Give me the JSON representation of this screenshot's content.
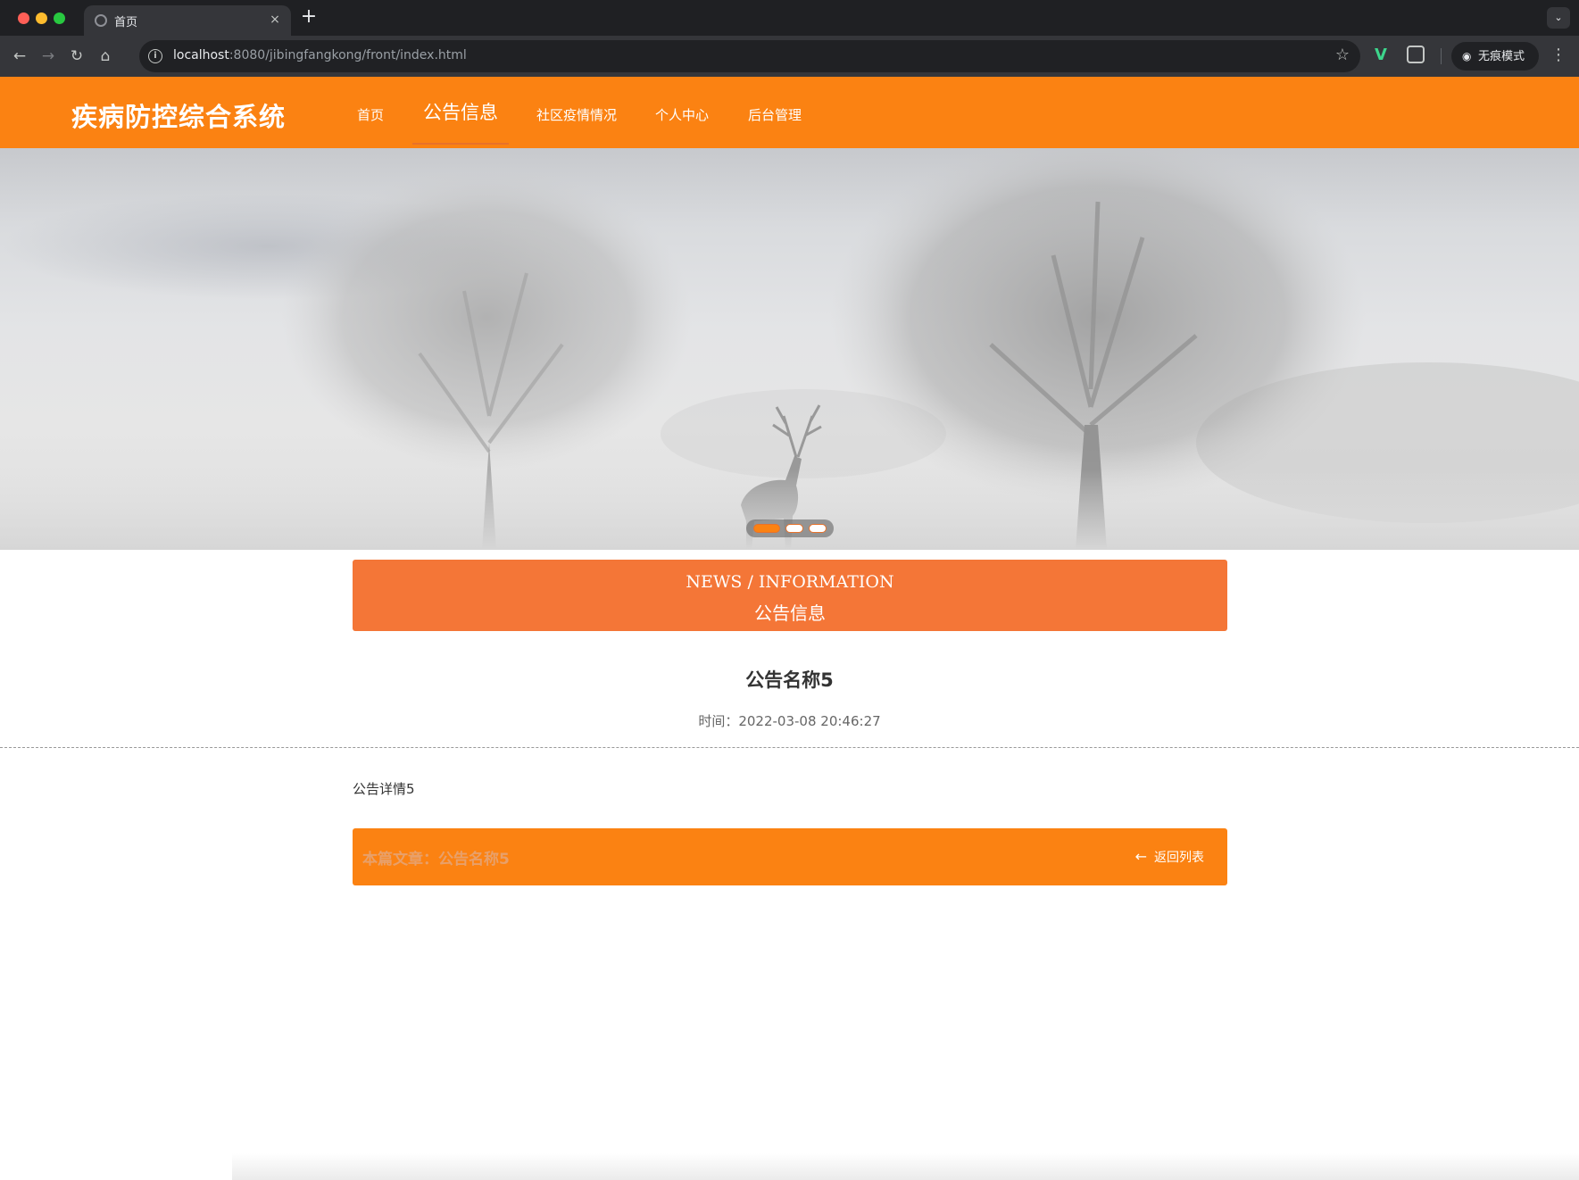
{
  "browser": {
    "tab_title": "首页",
    "tab_close": "×",
    "new_tab": "+",
    "url_host": "localhost",
    "url_rest": ":8080/jibingfangkong/front/index.html",
    "incognito_label": "无痕模式"
  },
  "header": {
    "site_title": "疾病防控综合系统",
    "nav": [
      {
        "label": "首页"
      },
      {
        "label": "公告信息"
      },
      {
        "label": "社区疫情情况"
      },
      {
        "label": "个人中心"
      },
      {
        "label": "后台管理"
      }
    ]
  },
  "carousel": {
    "total": 3,
    "active": 1
  },
  "section": {
    "en_title": "NEWS / INFORMATION",
    "cn_title": "公告信息"
  },
  "article": {
    "title": "公告名称5",
    "time_label": "时间：",
    "time_value": "2022-03-08 20:46:27",
    "body": "公告详情5"
  },
  "footer": {
    "current_label": "本篇文章：",
    "current_title": "公告名称5",
    "back_label": "返回列表"
  },
  "colors": {
    "brand_orange": "#fb8212",
    "section_orange": "#f47637"
  }
}
